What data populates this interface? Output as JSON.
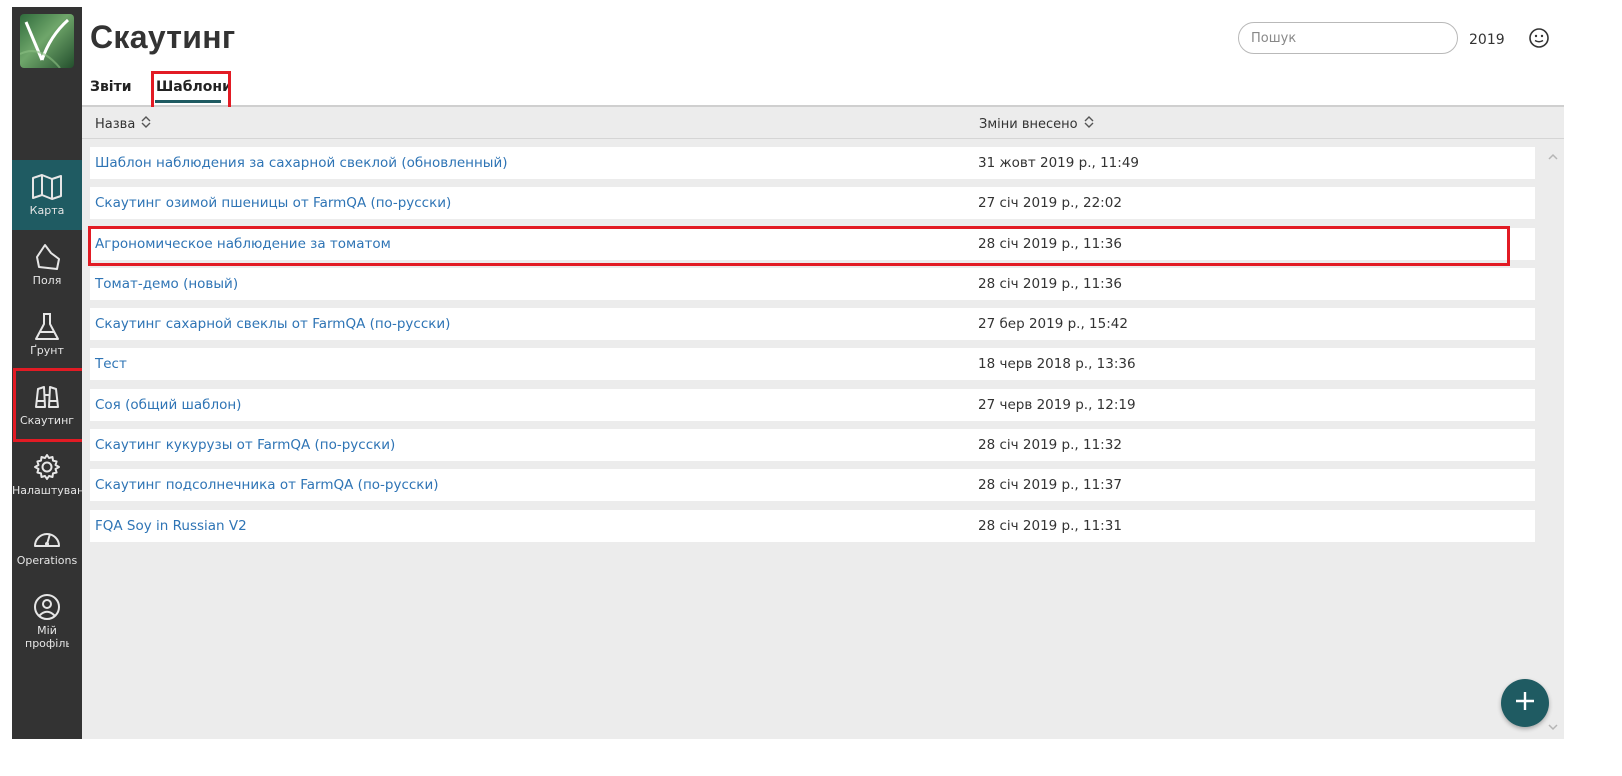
{
  "app": {
    "page_title": "Скаутинг",
    "search_placeholder": "Пошук",
    "year": "2019"
  },
  "tabs": [
    {
      "label": "Звіти",
      "active": false
    },
    {
      "label": "Шаблони",
      "active": true
    }
  ],
  "sidebar": {
    "items": [
      {
        "label": "Карта",
        "icon": "map-icon",
        "active": true
      },
      {
        "label": "Поля",
        "icon": "field-icon",
        "active": false
      },
      {
        "label": "Ґрунт",
        "icon": "flask-icon",
        "active": false
      },
      {
        "label": "Скаутинг",
        "icon": "binoculars-icon",
        "active": false
      },
      {
        "label": "Налаштування",
        "icon": "gear-icon",
        "active": false
      },
      {
        "label": "Operations",
        "icon": "gauge-icon",
        "active": false
      },
      {
        "label": "Мій профіль",
        "icon": "user-circle-icon",
        "active": false
      }
    ]
  },
  "table": {
    "columns": [
      "Назва",
      "Зміни внесено"
    ],
    "rows": [
      {
        "name": "Шаблон наблюдения за сахарной свеклой (обновленный)",
        "date": "31 жовт 2019 р., 11:49"
      },
      {
        "name": "Скаутинг озимой пшеницы от FarmQA (по-русски)",
        "date": "27 січ 2019 р., 22:02"
      },
      {
        "name": "Агрономическое наблюдение за томатом",
        "date": "28 січ 2019 р., 11:36"
      },
      {
        "name": "Томат-демо (новый)",
        "date": "28 січ 2019 р., 11:36"
      },
      {
        "name": "Скаутинг сахарной свеклы от FarmQA (по-русски)",
        "date": "27 бер 2019 р., 15:42"
      },
      {
        "name": "Тест",
        "date": "18 черв 2018 р., 13:36"
      },
      {
        "name": "Соя (общий шаблон)",
        "date": "27 черв 2019 р., 12:19"
      },
      {
        "name": "Скаутинг кукурузы от FarmQA (по-русски)",
        "date": "28 січ 2019 р., 11:32"
      },
      {
        "name": "Скаутинг подсолнечника от FarmQA (по-русски)",
        "date": "28 січ 2019 р., 11:37"
      },
      {
        "name": "FQA Soy in Russian V2",
        "date": "28 січ 2019 р., 11:31"
      }
    ]
  },
  "colors": {
    "accent": "#1f5b62",
    "link": "#2e74b5",
    "highlight": "#e21b24",
    "sidebar_bg": "#333333"
  }
}
